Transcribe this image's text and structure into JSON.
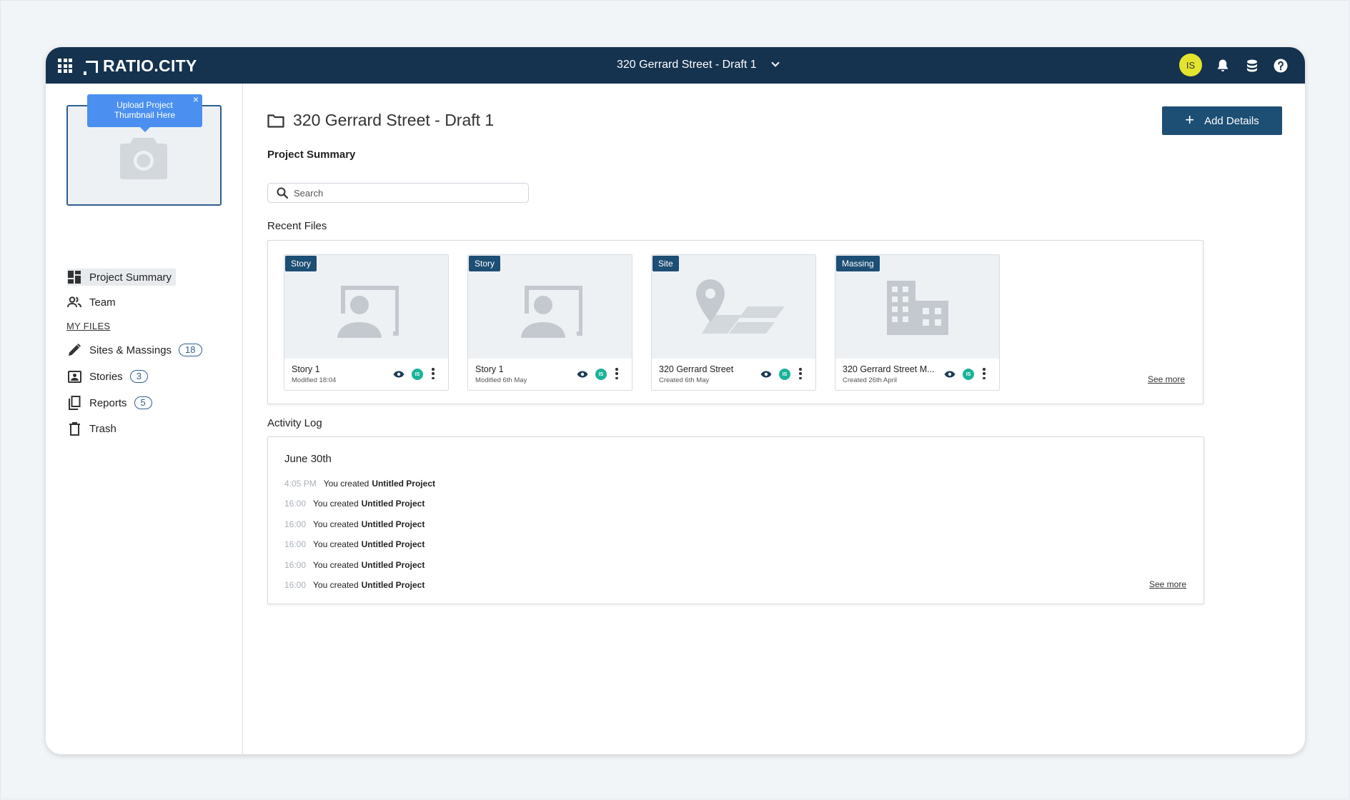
{
  "topbar": {
    "logo_text": "RATIO.CITY",
    "project_name": "320 Gerrard Street - Draft 1",
    "user_initials": "IS",
    "icons": [
      "apps-grid-icon",
      "bell-icon",
      "database-icon",
      "help-icon"
    ]
  },
  "sidebar": {
    "thumbnail_tooltip": "Upload Project Thumbnail Here",
    "tooltip_close": "×",
    "nav": [
      {
        "label": "Project Summary",
        "icon": "dashboard-icon"
      },
      {
        "label": "Team",
        "icon": "people-icon"
      }
    ],
    "my_files_label": "MY FILES",
    "files": [
      {
        "label": "Sites & Massings",
        "count": "18",
        "icon": "pencil-icon"
      },
      {
        "label": "Stories",
        "count": "3",
        "icon": "portrait-icon"
      },
      {
        "label": "Reports",
        "count": "5",
        "icon": "copy-icon"
      },
      {
        "label": "Trash",
        "icon": "trash-icon"
      }
    ]
  },
  "main": {
    "title": "320 Gerrard Street - Draft 1",
    "add_button": "Add Details",
    "subtitle": "Project Summary",
    "search_placeholder": "Search",
    "recent_files_label": "Recent Files",
    "recent_files": [
      {
        "tag": "Story",
        "title": "Story 1",
        "subtitle": "Modified 18:04",
        "art": "story"
      },
      {
        "tag": "Story",
        "title": "Story 1",
        "subtitle": "Modified 6th May",
        "art": "story"
      },
      {
        "tag": "Site",
        "title": "320 Gerrard Street",
        "subtitle": "Created 6th May",
        "art": "site"
      },
      {
        "tag": "Massing",
        "title": "320 Gerrard Street M...",
        "subtitle": "Created 26th April",
        "art": "massing"
      }
    ],
    "card_share_initials": "IS",
    "see_more_files": "See more",
    "activity_label": "Activity Log",
    "activity_date": "June 30th",
    "activity": [
      {
        "time": "4:05 PM",
        "text": "You created",
        "target": "Untitled Project"
      },
      {
        "time": "16:00",
        "text": "You created",
        "target": "Untitled Project"
      },
      {
        "time": "16:00",
        "text": "You created",
        "target": "Untitled Project"
      },
      {
        "time": "16:00",
        "text": "You created",
        "target": "Untitled Project"
      },
      {
        "time": "16:00",
        "text": "You created",
        "target": "Untitled Project"
      },
      {
        "time": "16:00",
        "text": "You created",
        "target": "Untitled Project"
      }
    ],
    "see_more_activity": "See more"
  },
  "colors": {
    "topbar": "#15324f",
    "primary": "#1d4e74",
    "tooltip": "#4b90f0",
    "avatar": "#e4e42f",
    "share": "#1bb39a"
  }
}
